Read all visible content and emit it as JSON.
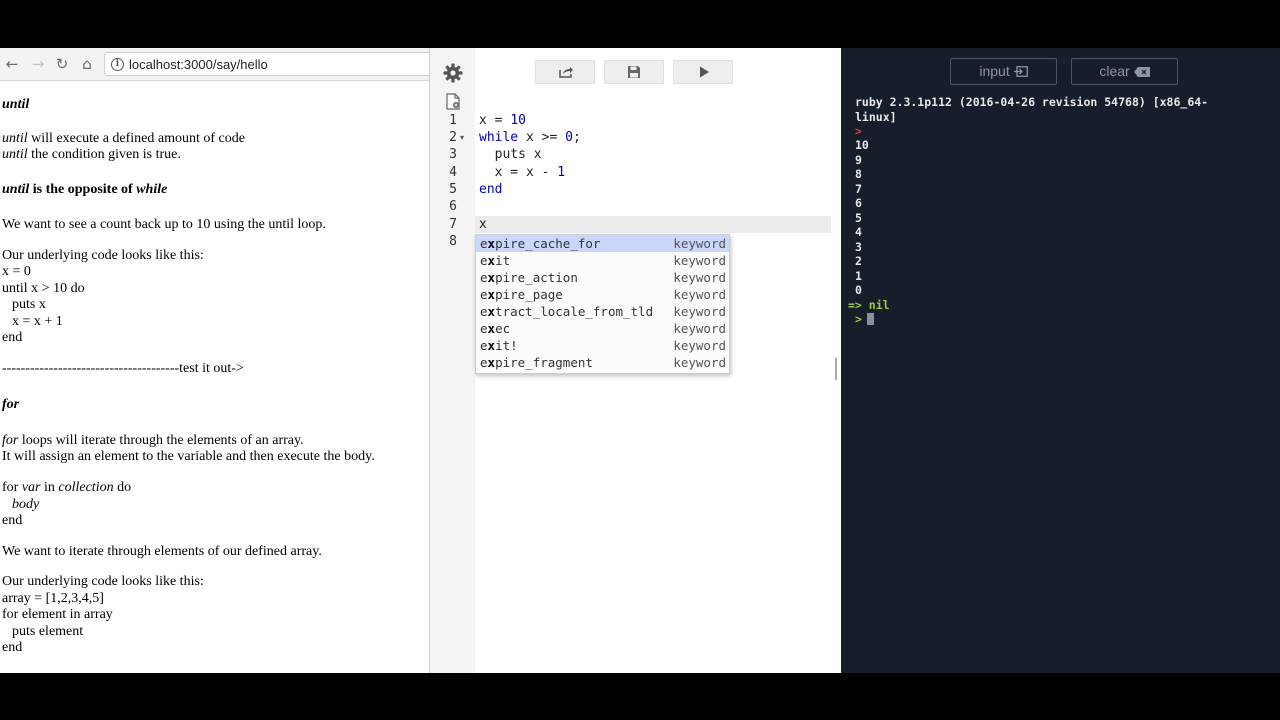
{
  "browser": {
    "url": "localhost:3000/say/hello",
    "content": [
      {
        "key": "until_h",
        "text": "until"
      },
      {
        "key": "until_1a",
        "text": "until"
      },
      {
        "key": "until_1b",
        "text": " will execute a defined amount of code"
      },
      {
        "key": "until_2a",
        "text": "until"
      },
      {
        "key": "until_2b",
        "text": " the condition given is true."
      },
      {
        "key": "opp_a",
        "text": "until"
      },
      {
        "key": "opp_b",
        "text": " is the opposite of "
      },
      {
        "key": "opp_c",
        "text": "while"
      },
      {
        "key": "want1",
        "text": "We want to see a count back up to 10 using the until loop."
      },
      {
        "key": "under1",
        "text": "Our underlying code looks like this:"
      },
      {
        "key": "c1",
        "text": "x = 0"
      },
      {
        "key": "c2",
        "text": "until x > 10 do"
      },
      {
        "key": "c3",
        "text": "puts x"
      },
      {
        "key": "c4",
        "text": "x = x + 1"
      },
      {
        "key": "c5",
        "text": "end"
      },
      {
        "key": "test",
        "text": "--------------------------------------test it out->"
      },
      {
        "key": "for_h",
        "text": "for"
      },
      {
        "key": "for1a",
        "text": "for"
      },
      {
        "key": "for1b",
        "text": " loops will iterate through the elements of an array."
      },
      {
        "key": "for2",
        "text": "It will assign an element to the variable and then execute the body."
      },
      {
        "key": "f1a",
        "text": "for "
      },
      {
        "key": "f1b",
        "text": "var"
      },
      {
        "key": "f1c",
        "text": " in "
      },
      {
        "key": "f1d",
        "text": "collection"
      },
      {
        "key": "f1e",
        "text": " do"
      },
      {
        "key": "f2",
        "text": "body"
      },
      {
        "key": "f3",
        "text": "end"
      },
      {
        "key": "want2",
        "text": "We want to iterate through elements of our defined array."
      },
      {
        "key": "under2",
        "text": "Our underlying code looks like this:"
      },
      {
        "key": "a1",
        "text": "array = [1,2,3,4,5]"
      },
      {
        "key": "a2",
        "text": "for element in array"
      },
      {
        "key": "a3",
        "text": "puts element"
      },
      {
        "key": "a4",
        "text": "end"
      }
    ]
  },
  "editor": {
    "toolbar": {
      "share_icon": "share-icon",
      "save_icon": "save-icon",
      "run_icon": "run-icon"
    },
    "line_numbers": [
      "1",
      "2",
      "3",
      "4",
      "5",
      "6",
      "7",
      "8"
    ],
    "code": {
      "l1_kw": "x = ",
      "l1_num": "10",
      "l2_kw": "while",
      "l2_rest": " x >= ",
      "l2_num": "0",
      "l2_end": ";",
      "l3": "  puts x",
      "l4_a": "  x = x - ",
      "l4_num": "1",
      "l5": "end",
      "l7": "x"
    },
    "autocomplete": [
      {
        "prefix": "e",
        "match": "x",
        "rest": "pire_cache_for",
        "meta": "keyword"
      },
      {
        "prefix": "e",
        "match": "x",
        "rest": "it",
        "meta": "keyword"
      },
      {
        "prefix": "e",
        "match": "x",
        "rest": "pire_action",
        "meta": "keyword"
      },
      {
        "prefix": "e",
        "match": "x",
        "rest": "pire_page",
        "meta": "keyword"
      },
      {
        "prefix": "e",
        "match": "x",
        "rest": "tract_locale_from_tld",
        "meta": "keyword"
      },
      {
        "prefix": "e",
        "match": "x",
        "rest": "ec",
        "meta": "keyword"
      },
      {
        "prefix": "e",
        "match": "x",
        "rest": "it!",
        "meta": "keyword"
      },
      {
        "prefix": "e",
        "match": "x",
        "rest": "pire_fragment",
        "meta": "keyword"
      }
    ]
  },
  "console": {
    "input_label": "input",
    "clear_label": "clear",
    "version_1": "ruby 2.3.1p112 (2016-04-26 revision 54768) [x86_64-",
    "version_2": "linux]",
    "prompt": ">",
    "output": [
      "10",
      "9",
      "8",
      "7",
      "6",
      "5",
      "4",
      "3",
      "2",
      "1",
      "0"
    ],
    "result": "=> nil",
    "colors": {
      "bg": "#161d2b",
      "prompt_red": "#d9453f",
      "prompt_green": "#9bcf3a"
    }
  }
}
